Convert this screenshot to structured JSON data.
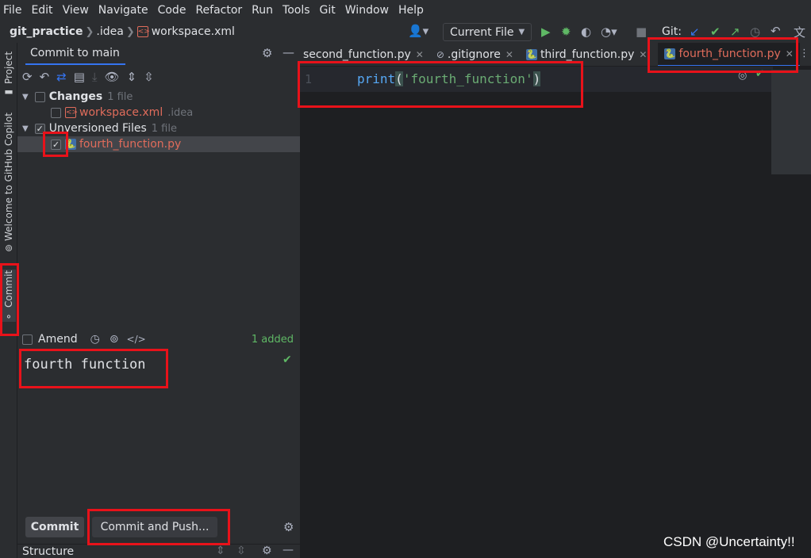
{
  "menu": [
    "File",
    "Edit",
    "View",
    "Navigate",
    "Code",
    "Refactor",
    "Run",
    "Tools",
    "Git",
    "Window",
    "Help"
  ],
  "breadcrumb": {
    "project": "git_practice",
    "folder": ".idea",
    "file": "workspace.xml"
  },
  "toolbar": {
    "run_config": "Current File",
    "git_label": "Git:"
  },
  "sidebar_tabs": {
    "project": "Project",
    "copilot": "Welcome to GitHub Copilot",
    "commit": "Commit"
  },
  "commit_panel": {
    "title": "Commit to main",
    "changes": {
      "label": "Changes",
      "count": "1 file",
      "file": "workspace.xml",
      "file_dir": ".idea"
    },
    "unversioned": {
      "label": "Unversioned Files",
      "count": "1 file",
      "file": "fourth_function.py"
    },
    "amend_label": "Amend",
    "added_status": "1 added",
    "message": "fourth function",
    "commit_button": "Commit",
    "commit_push_button": "Commit and Push...",
    "structure_label": "Structure"
  },
  "editor": {
    "tabs": [
      {
        "label": "second_function.py"
      },
      {
        "label": ".gitignore"
      },
      {
        "label": "third_function.py"
      },
      {
        "label": "fourth_function.py",
        "active": true
      }
    ],
    "line_number": "1",
    "code": {
      "func": "print",
      "open": "(",
      "string": "'fourth_function'",
      "close": ")"
    }
  },
  "watermark": "CSDN @Uncertainty!!",
  "colors": {
    "accent": "#3574f0",
    "unversioned": "#e06c5b",
    "highlight": "#e8121a",
    "added": "#5fb865"
  }
}
